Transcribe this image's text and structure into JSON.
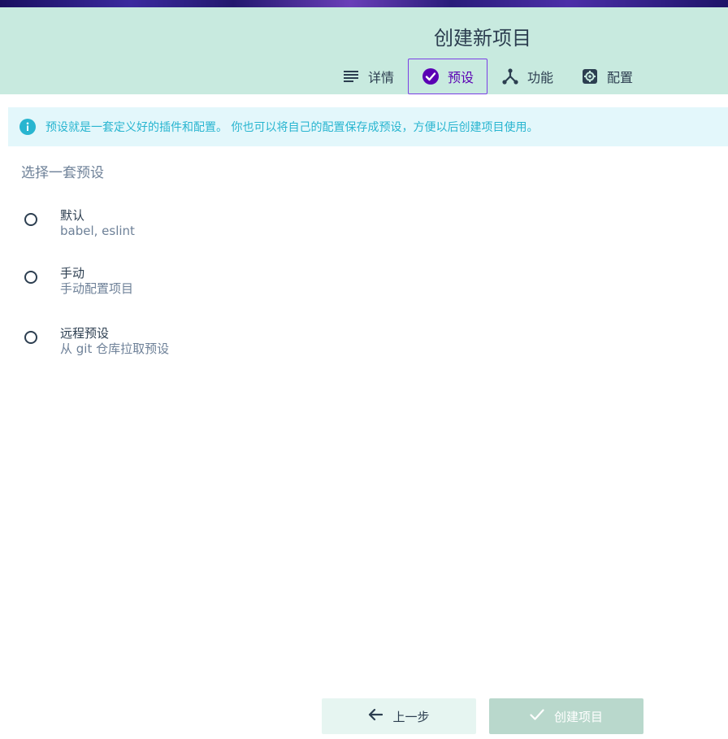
{
  "header": {
    "title": "创建新项目"
  },
  "tabs": [
    {
      "label": "详情",
      "icon": "list-icon"
    },
    {
      "label": "预设",
      "icon": "check-circle-icon",
      "active": true
    },
    {
      "label": "功能",
      "icon": "fork-icon"
    },
    {
      "label": "配置",
      "icon": "gear-icon"
    }
  ],
  "info": {
    "icon": "info-icon",
    "text": "预设就是一套定义好的插件和配置。 你也可以将自己的配置保存成预设，方便以后创建项目使用。"
  },
  "section_title": "选择一套预设",
  "presets": [
    {
      "name": "默认",
      "description": "babel, eslint",
      "selected": false
    },
    {
      "name": "手动",
      "description": "手动配置项目",
      "selected": false
    },
    {
      "name": "远程预设",
      "description": "从 git 仓库拉取预设",
      "selected": false
    }
  ],
  "footer": {
    "prev_label": "上一步",
    "create_label": "创建项目",
    "create_disabled": true
  },
  "colors": {
    "header_bg": "#c8eadf",
    "accent": "#5a00b4",
    "info_bg": "#e3f7fb",
    "info_text": "#28b5d0"
  }
}
